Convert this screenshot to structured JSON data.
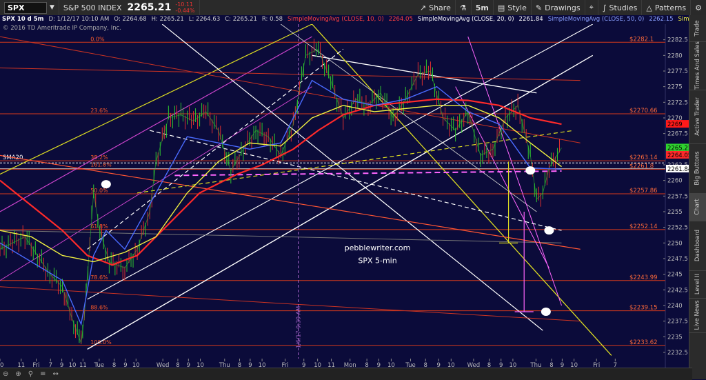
{
  "toolbar": {
    "symbol": "SPX",
    "index_name": "S&P 500 INDEX",
    "last": "2265.21",
    "change": "-10.11",
    "change_pct": "-0.44%",
    "share": "Share",
    "interval": "5m",
    "style": "Style",
    "drawings": "Drawings",
    "studies": "Studies",
    "patterns": "Patterns"
  },
  "infobar": {
    "title": "SPX 10 d 5m",
    "datetime": "D: 1/12/17 10:10 AM",
    "open": "O: 2264.68",
    "high": "H: 2265.21",
    "low": "L: 2264.63",
    "close": "C: 2265.21",
    "rate": "R: 0.58",
    "sma10": "SimpleMovingAvg (CLOSE, 10, 0)",
    "sma10_val": "2264.05",
    "sma20": "SimpleMovingAvg (CLOSE, 20, 0)",
    "sma20_val": "2261.84",
    "sma50": "SimpleMovingAvg (CLOSE, 50, 0)",
    "sma50_val": "2262.15",
    "sma_more": "SimpleMoving..."
  },
  "copyright": "© 2016 TD Ameritrade IP Company, Inc.",
  "sidebar": [
    "Trade",
    "Times And Sales",
    "Active Trader",
    "Big Buttons",
    "Chart",
    "Dashboard",
    "Level II",
    "Live News"
  ],
  "chart_data": {
    "type": "line",
    "title": "pebblewriter.com",
    "subtitle": "SPX 5-min",
    "ylim": [
      2231.5,
      2285
    ],
    "y_ticks": [
      "2282.5",
      "2280",
      "2277.5",
      "2275",
      "2272.5",
      "2270",
      "2267.5",
      "2262.5",
      "2260",
      "2257.5",
      "2255",
      "2252.5",
      "2250",
      "2247.5",
      "2245",
      "2242.5",
      "2240",
      "2237.5",
      "2235",
      "2232.5"
    ],
    "y_tick_values": [
      2282.5,
      2280,
      2277.5,
      2275,
      2272.5,
      2270,
      2267.5,
      2262.5,
      2260,
      2257.5,
      2255,
      2252.5,
      2250,
      2247.5,
      2245,
      2242.5,
      2240,
      2237.5,
      2235,
      2232.5
    ],
    "x_ticks": [
      "10",
      "11",
      "Fri",
      "7",
      "9",
      "10",
      "11",
      "Tue",
      "8",
      "9",
      "10",
      "Wed",
      "8",
      "9",
      "10",
      "Thu",
      "8",
      "9",
      "10",
      "Fri",
      "9",
      "10",
      "11",
      "Mon",
      "8",
      "9",
      "10",
      "Tue",
      "8",
      "9",
      "10",
      "Wed",
      "8",
      "9",
      "10",
      "Thu",
      "8",
      "9",
      "10",
      "Fri",
      "7"
    ],
    "x_tick_pos": [
      0.0,
      0.034,
      0.058,
      0.081,
      0.099,
      0.116,
      0.133,
      0.159,
      0.183,
      0.201,
      0.218,
      0.261,
      0.285,
      0.302,
      0.321,
      0.36,
      0.384,
      0.401,
      0.42,
      0.457,
      0.487,
      0.509,
      0.531,
      0.561,
      0.588,
      0.607,
      0.627,
      0.658,
      0.682,
      0.703,
      0.723,
      0.759,
      0.784,
      0.803,
      0.822,
      0.859,
      0.884,
      0.901,
      0.92,
      0.956,
      0.986
    ],
    "fib_labels": [
      {
        "label": "0.0%",
        "value": 2282.1
      },
      {
        "label": "23.6%",
        "value": 2270.66
      },
      {
        "label": "38.2%",
        "value": 2263.14
      },
      {
        "label": "161.8%",
        "value": 2262.0
      },
      {
        "label": "50.0%",
        "value": 2257.86
      },
      {
        "label": "61.8%",
        "value": 2252.14
      },
      {
        "label": "78.6%",
        "value": 2243.99
      },
      {
        "label": "88.6%",
        "value": 2239.15
      },
      {
        "label": "100.0%",
        "value": 2233.62
      }
    ],
    "levels": [
      {
        "label": "$2282.1",
        "value": 2282.1
      },
      {
        "label": "$2270.66",
        "value": 2270.66
      },
      {
        "label": "$2263.14",
        "value": 2263.14
      },
      {
        "label": "$2261.8",
        "value": 2261.8
      },
      {
        "label": "$2257.86",
        "value": 2257.86
      },
      {
        "label": "$2252.14",
        "value": 2252.14
      },
      {
        "label": "$2243.99",
        "value": 2243.99
      },
      {
        "label": "$2239.15",
        "value": 2239.15
      },
      {
        "label": "$2233.62",
        "value": 2233.62
      }
    ],
    "badges": [
      {
        "label": "2269",
        "value": 2269.0,
        "color": "#ff1a1a",
        "text_color": "#000000"
      },
      {
        "label": "2265.21",
        "value": 2265.21,
        "color": "#2fd12f",
        "text_color": "#000000"
      },
      {
        "label": "2264.05",
        "value": 2264.05,
        "color": "#ff2a2a",
        "text_color": "#000000"
      },
      {
        "label": "2261.84",
        "value": 2261.84,
        "color": "#ffffff",
        "text_color": "#000000"
      }
    ],
    "sma20_label": "SMA20",
    "vline_label": "1/6/17 9:39 AM",
    "series": [
      {
        "name": "SPX",
        "color": "#2fc52f",
        "x": [
          0.0,
          0.02,
          0.04,
          0.06,
          0.08,
          0.1,
          0.115,
          0.13,
          0.135,
          0.15,
          0.16,
          0.175,
          0.2,
          0.22,
          0.24,
          0.25,
          0.27,
          0.29,
          0.31,
          0.33,
          0.35,
          0.37,
          0.39,
          0.41,
          0.43,
          0.45,
          0.47,
          0.49,
          0.51,
          0.53,
          0.55,
          0.57,
          0.59,
          0.61,
          0.63,
          0.65,
          0.67,
          0.69,
          0.71,
          0.73,
          0.75,
          0.77,
          0.79,
          0.81,
          0.83,
          0.85,
          0.86,
          0.87,
          0.88,
          0.9
        ],
        "y": [
          2249,
          2250,
          2251,
          2248,
          2245,
          2243,
          2238,
          2234,
          2238,
          2258,
          2252,
          2247,
          2246,
          2249,
          2255,
          2263,
          2270,
          2270.5,
          2269.5,
          2271,
          2268,
          2261.5,
          2265,
          2268,
          2267,
          2264,
          2269,
          2280,
          2281,
          2276,
          2270,
          2273,
          2272,
          2274,
          2270,
          2273,
          2277,
          2277.5,
          2270,
          2268,
          2271,
          2264,
          2265,
          2270,
          2272,
          2264,
          2257,
          2258,
          2262,
          2265.2
        ]
      },
      {
        "name": "SMA10",
        "color": "#ff2a2a",
        "x": [
          0.0,
          0.05,
          0.1,
          0.14,
          0.18,
          0.22,
          0.27,
          0.32,
          0.38,
          0.42,
          0.47,
          0.51,
          0.55,
          0.6,
          0.65,
          0.7,
          0.75,
          0.8,
          0.85,
          0.9
        ],
        "y": [
          2260,
          2256,
          2252,
          2248,
          2246.5,
          2248,
          2253,
          2258,
          2261,
          2262.5,
          2265,
          2268,
          2270.5,
          2272,
          2272.5,
          2273,
          2272.8,
          2272,
          2270,
          2269
        ]
      },
      {
        "name": "SMA20",
        "color": "#4a6bff",
        "x": [
          0.0,
          0.1,
          0.13,
          0.15,
          0.17,
          0.2,
          0.25,
          0.3,
          0.35,
          0.4,
          0.45,
          0.5,
          0.55,
          0.6,
          0.65,
          0.7,
          0.75,
          0.8,
          0.85,
          0.9
        ],
        "y": [
          2250,
          2244,
          2237,
          2248,
          2252,
          2249,
          2258,
          2267,
          2266,
          2265,
          2266,
          2276,
          2273,
          2272,
          2273,
          2275,
          2271,
          2269,
          2262,
          2261.8
        ]
      },
      {
        "name": "SMA50",
        "color": "#f0f040",
        "x": [
          0.0,
          0.05,
          0.1,
          0.15,
          0.2,
          0.25,
          0.3,
          0.35,
          0.4,
          0.45,
          0.5,
          0.55,
          0.6,
          0.65,
          0.7,
          0.75,
          0.8,
          0.85,
          0.9
        ],
        "y": [
          2252,
          2251,
          2248,
          2247,
          2248.5,
          2251,
          2258,
          2263,
          2266,
          2265.5,
          2270,
          2272,
          2271,
          2271.5,
          2272,
          2272,
          2270,
          2266,
          2262.2
        ]
      }
    ]
  }
}
